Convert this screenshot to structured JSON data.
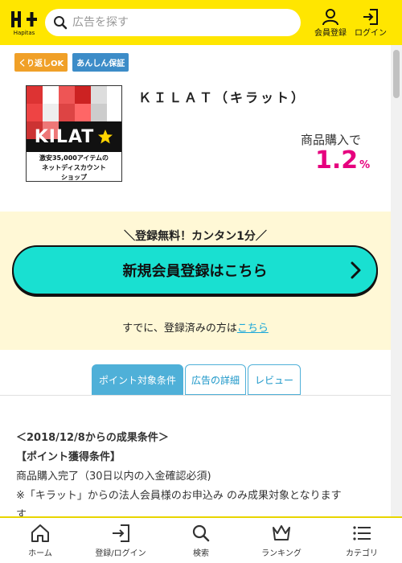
{
  "header": {
    "logo_text": "Hapitas",
    "search_placeholder": "広告を探す",
    "register_label": "会員登録",
    "login_label": "ログイン"
  },
  "badges": [
    "くり返しOK",
    "あんしん保証"
  ],
  "product": {
    "title": "ＫＩＬＡＴ（キラット）",
    "image_brand": "KILAT",
    "image_tagline_1": "激安35,000アイテムの",
    "image_tagline_2": "ネットディスカウント",
    "image_tagline_3": "ショップ",
    "reward_label": "商品購入で",
    "reward_value": "1.2",
    "reward_unit": "%"
  },
  "signup": {
    "tagline": "＼登録無料！カンタン1分／",
    "button_label": "新規会員登録はこちら",
    "already_text": "すでに、登録済みの方は",
    "already_link": "こちら"
  },
  "tabs": [
    {
      "label": "ポイント対象条件",
      "active": true
    },
    {
      "label": "広告の詳細",
      "active": false
    },
    {
      "label": "レビュー",
      "active": false
    }
  ],
  "conditions": {
    "line1": "＜2018/12/8からの成果条件＞",
    "line2": "【ポイント獲得条件】",
    "line3": "商品購入完了（30日以内の入金確認必須)",
    "line4": "※「キラット」からの法人会員様のお申込み のみ成果対象となります",
    "line5": "す"
  },
  "bottom_nav": {
    "home": "ホーム",
    "login": "登録/ログイン",
    "search": "検索",
    "ranking": "ランキング",
    "category": "カテゴリ"
  },
  "colors": {
    "header": "#ffe600",
    "accent_pink": "#e6007e",
    "signup_button": "#19e0d1",
    "tab_blue": "#4fb0d8"
  }
}
